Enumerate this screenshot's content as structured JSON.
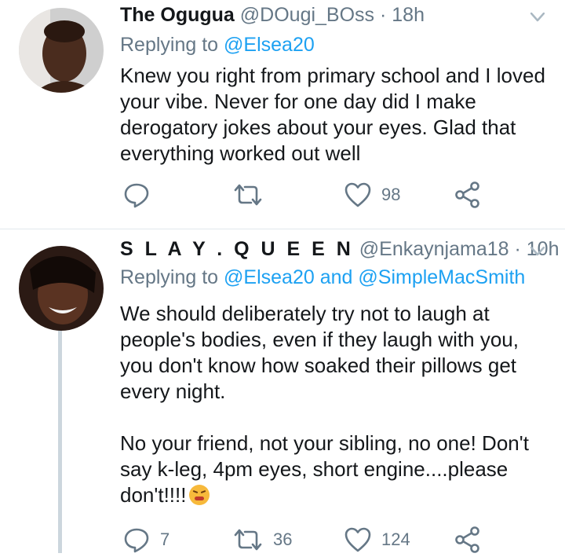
{
  "tweets": [
    {
      "name": "The Ogugua",
      "handle": "@DOugi_BOss",
      "separator": "·",
      "time": "18h",
      "replying_prefix": "Replying to",
      "replying_to": [
        "@Elsea20"
      ],
      "replying_joiner": "",
      "paragraphs": [
        "Knew you right from primary school and I loved your vibe. Never for one day did I make derogatory jokes about your eyes. Glad that everything worked out well"
      ],
      "actions": {
        "reply_count": "",
        "retweet_count": "",
        "like_count": "98"
      },
      "icons": [
        "reply-icon",
        "retweet-icon",
        "heart-icon",
        "share-icon",
        "chevron-down-icon"
      ]
    },
    {
      "name": "S L A Y . Q U E E N",
      "name_raw": "SLAY.QUEEN",
      "handle": "@Enkaynjama18",
      "separator": "·",
      "time": "10h",
      "replying_prefix": "Replying to",
      "replying_to": [
        "@Elsea20",
        "@SimpleMacSmith"
      ],
      "replying_joiner": "and",
      "paragraphs": [
        "We should deliberately try not to laugh at people's bodies, even if they laugh with you, you don't know how soaked their pillows get every night.",
        "No your friend, not your sibling, no one! Don't say k-leg, 4pm eyes, short engine....please don't!!!!"
      ],
      "actions": {
        "reply_count": "7",
        "retweet_count": "36",
        "like_count": "124"
      },
      "icons": [
        "reply-icon",
        "retweet-icon",
        "heart-icon",
        "share-icon",
        "chevron-down-icon",
        "emoji-icon"
      ]
    }
  ],
  "colors": {
    "text": "#14171a",
    "muted": "#657786",
    "link": "#1da1f2",
    "divider": "#e1e8ed",
    "thread_line": "#ccd6dd"
  }
}
